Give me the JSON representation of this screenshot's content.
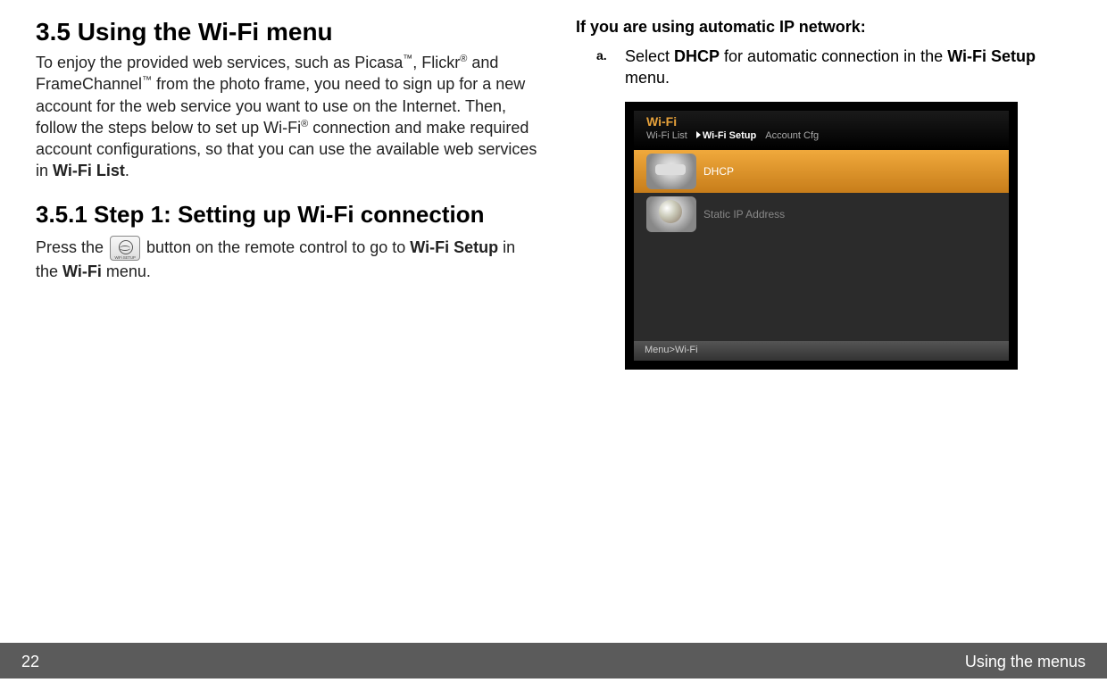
{
  "left": {
    "heading_main": "3.5    Using the Wi-Fi menu",
    "para1_a": "To enjoy the provided web services, such as Picasa",
    "para1_b": ", Flickr",
    "para1_c": " and FrameChannel",
    "para1_d": " from the photo frame, you need to sign up for a new account for the web service you want to use on the Internet. Then, follow the steps below to set up Wi-Fi",
    "para1_e": " connection and make required account configurations, so that you can use the available web services in ",
    "para1_bold1": "Wi-Fi List",
    "para1_end": ".",
    "heading_sub": "3.5.1   Step 1: Setting up Wi-Fi connection",
    "para2_a": "Press the ",
    "para2_b": " button on the remote control to go to ",
    "para2_bold1": "Wi-Fi Setup",
    "para2_c": " in the ",
    "para2_bold2": "Wi-Fi",
    "para2_d": " menu.",
    "icon_label": "WiFi SETUP"
  },
  "right": {
    "heading": "If you are using automatic IP network:",
    "step_marker": "a.",
    "step_a1": "Select ",
    "step_bold1": "DHCP",
    "step_a2": " for automatic connection in the ",
    "step_bold2": "Wi-Fi Setup",
    "step_a3": " menu."
  },
  "shot": {
    "title": "Wi-Fi",
    "tab1": "Wi-Fi  List",
    "tab2": "Wi-Fi Setup",
    "tab3": "Account Cfg",
    "row1": "DHCP",
    "row2": "Static IP Address",
    "breadcrumb": "Menu>Wi-Fi"
  },
  "footer": {
    "page": "22",
    "section": "Using the menus"
  }
}
